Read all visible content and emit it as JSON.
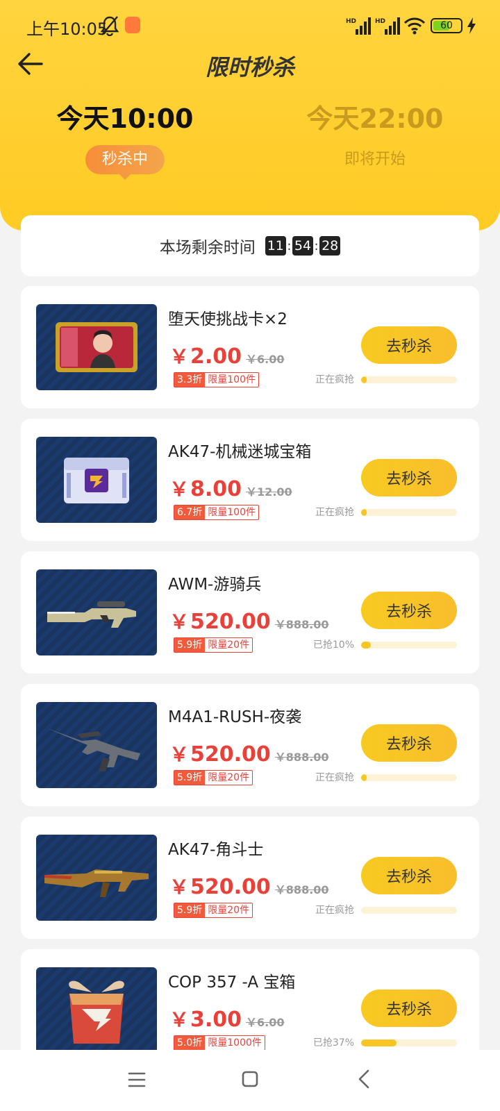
{
  "status_bar": {
    "time": "上午10:05",
    "network_1": "HD",
    "network_2": "HD",
    "battery": "60",
    "battery_level": 0.6,
    "icons": [
      "bell-muted-icon",
      "app-badge-icon",
      "signal-icon",
      "signal-icon",
      "wifi-icon",
      "battery-icon",
      "charging-bolt-icon"
    ]
  },
  "header": {
    "title": "限时秒杀",
    "back_icon": "arrow-left-icon"
  },
  "sessions": [
    {
      "time": "今天10:00",
      "status": "秒杀中",
      "active": true
    },
    {
      "time": "今天22:00",
      "status": "即将开始",
      "active": false
    }
  ],
  "countdown": {
    "label": "本场剩余时间",
    "hours": "11",
    "minutes": "54",
    "seconds": "28",
    "separator": ":"
  },
  "products": [
    {
      "name": "堕天使挑战卡×2",
      "currency": "￥",
      "price": "2.00",
      "original_price": "￥6.00",
      "discount": "3.3折",
      "limit": "限量100件",
      "button": "去秒杀",
      "progress_text": "正在疯抢",
      "progress": 0.01,
      "image": "challenge-card"
    },
    {
      "name": "AK47-机械迷城宝箱",
      "currency": "￥",
      "price": "8.00",
      "original_price": "￥12.00",
      "discount": "6.7折",
      "limit": "限量100件",
      "button": "去秒杀",
      "progress_text": "正在疯抢",
      "progress": 0.01,
      "image": "treasure-chest"
    },
    {
      "name": "AWM-游骑兵",
      "currency": "￥",
      "price": "520.00",
      "original_price": "￥888.00",
      "discount": "5.9折",
      "limit": "限量20件",
      "button": "去秒杀",
      "progress_text": "已抢10%",
      "progress": 0.1,
      "image": "sniper-rifle"
    },
    {
      "name": "M4A1-RUSH-夜袭",
      "currency": "￥",
      "price": "520.00",
      "original_price": "￥888.00",
      "discount": "5.9折",
      "limit": "限量20件",
      "button": "去秒杀",
      "progress_text": "正在疯抢",
      "progress": 0.05,
      "image": "assault-rifle"
    },
    {
      "name": "AK47-角斗士",
      "currency": "￥",
      "price": "520.00",
      "original_price": "￥888.00",
      "discount": "5.9折",
      "limit": "限量20件",
      "button": "去秒杀",
      "progress_text": "正在疯抢",
      "progress": 0.0,
      "image": "ak47-rifle"
    },
    {
      "name": "COP 357 -A 宝箱",
      "currency": "￥",
      "price": "3.00",
      "original_price": "￥6.00",
      "discount": "5.0折",
      "limit": "限量1000件",
      "button": "去秒杀",
      "progress_text": "已抢37%",
      "progress": 0.37,
      "image": "gift-box"
    }
  ],
  "nav_bar": {
    "icons": [
      "menu-icon",
      "home-icon",
      "back-icon"
    ]
  },
  "colors": {
    "header_yellow": "#ffcb24",
    "price_red": "#e8413a",
    "button_yellow": "#f7ca21",
    "pill_orange": "#f78d3a"
  }
}
